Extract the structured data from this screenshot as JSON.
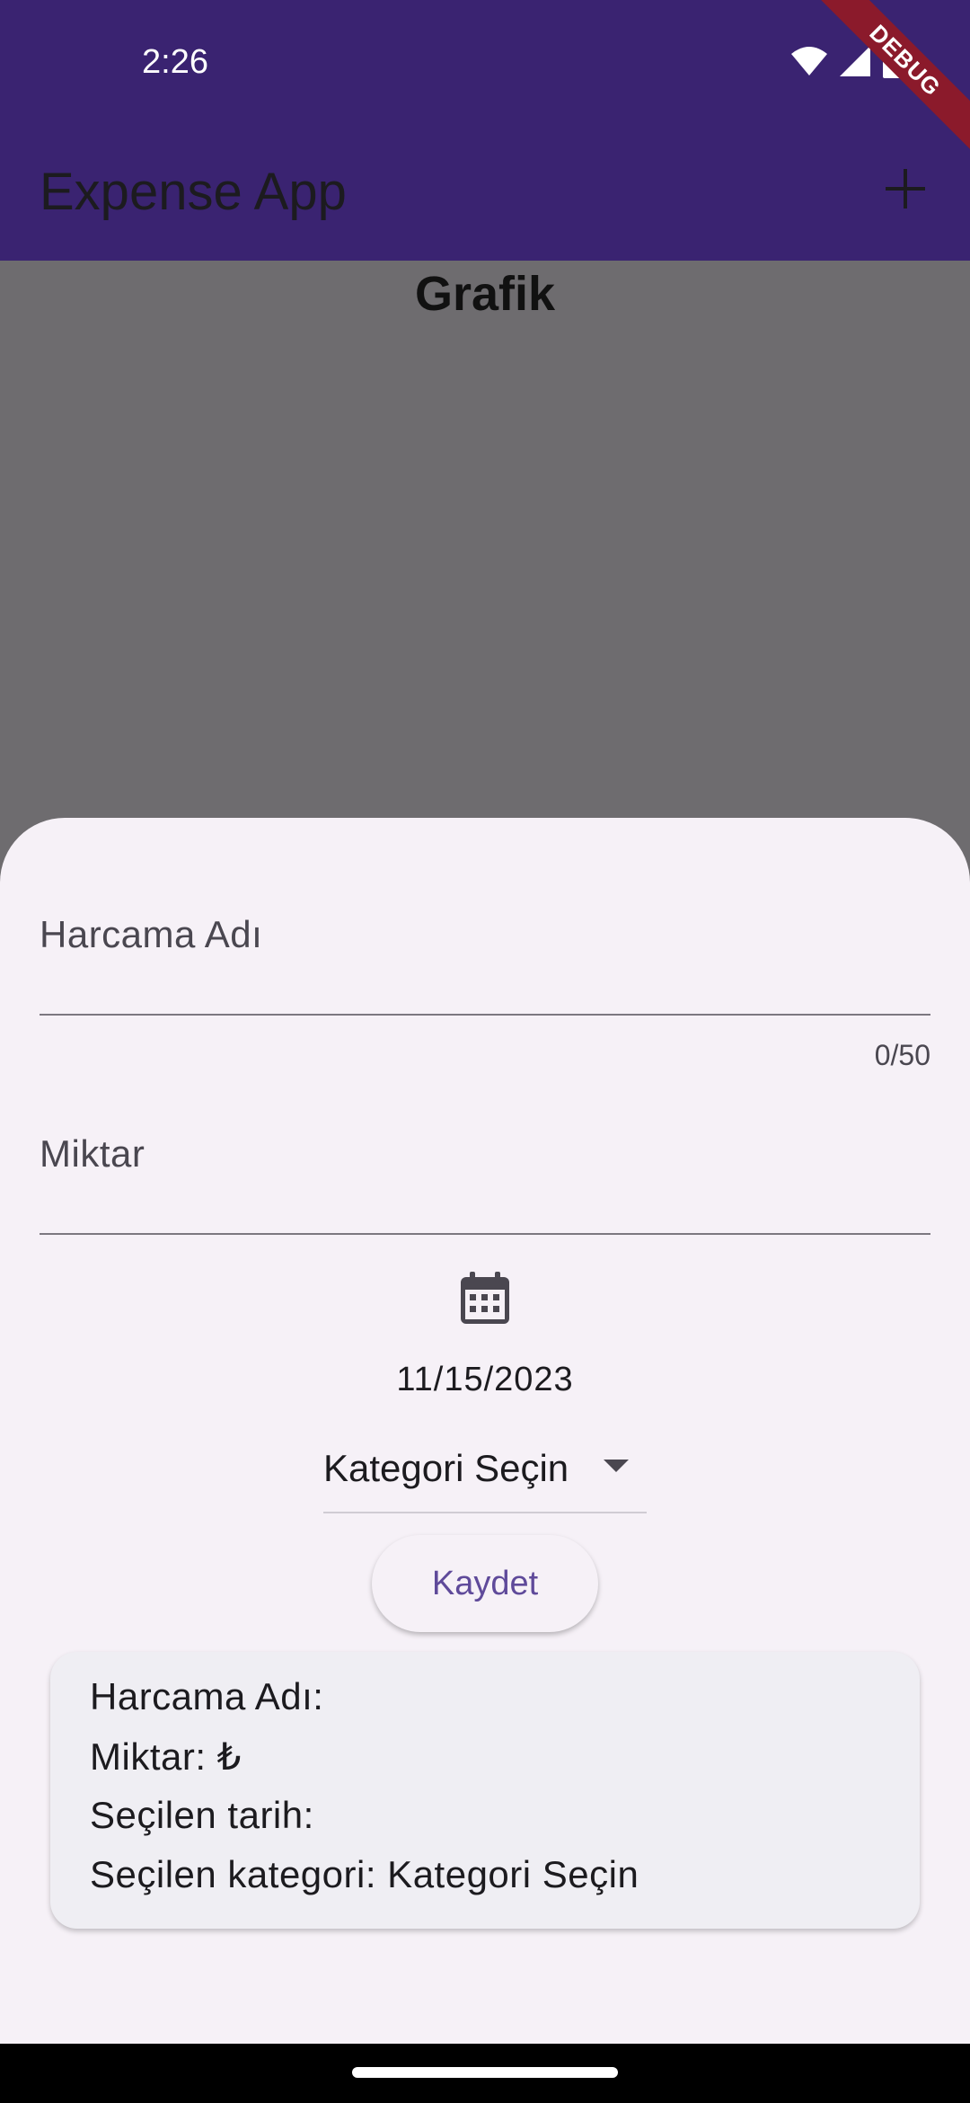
{
  "status_bar": {
    "time": "2:26"
  },
  "debug_banner": "DEBUG",
  "app_bar": {
    "title": "Expense App",
    "add_icon": "plus-icon"
  },
  "chart": {
    "title": "Grafik"
  },
  "form": {
    "name_label": "Harcama Adı",
    "name_value": "",
    "name_counter": "0/50",
    "amount_label": "Miktar",
    "amount_value": "",
    "calendar_icon": "calendar-icon",
    "selected_date": "11/15/2023",
    "category_value": "Kategori Seçin",
    "save_label": "Kaydet"
  },
  "summary": {
    "name_line": "Harcama Adı:",
    "amount_line": "Miktar:  ₺",
    "date_line": "Seçilen tarih:",
    "category_line": "Seçilen kategori: Kategori Seçin"
  },
  "colors": {
    "app_bar": "#3a2371",
    "scrim": "#6e6c6f",
    "sheet": "#f6f1f7",
    "accent": "#5f4a9a"
  }
}
